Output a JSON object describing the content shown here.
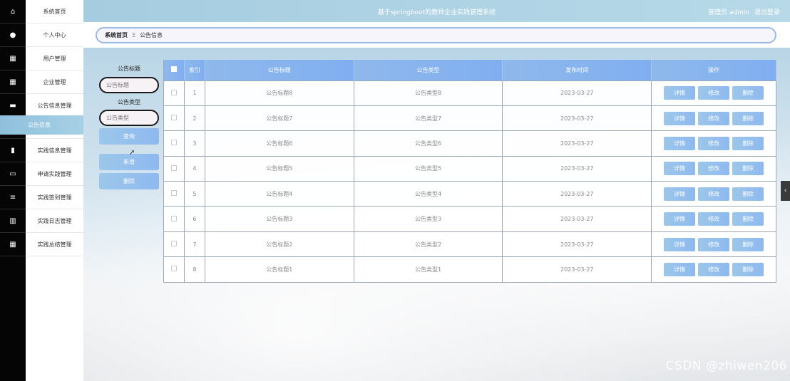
{
  "app": {
    "title": "基于springboot的教师企业实践管理系统",
    "user_role": "管理员 admin",
    "logout": "退出登录"
  },
  "sidebar": {
    "items": [
      {
        "label": "系统首页",
        "icon": "home-icon"
      },
      {
        "label": "个人中心",
        "icon": "user-icon"
      },
      {
        "label": "用户管理",
        "icon": "grid-icon"
      },
      {
        "label": "企业管理",
        "icon": "grid-icon"
      },
      {
        "label": "公告信息管理",
        "icon": "monitor-icon"
      },
      {
        "label": "公告信息",
        "icon": "",
        "active": true
      },
      {
        "label": "实践信息管理",
        "icon": "clipboard-icon"
      },
      {
        "label": "申请实践管理",
        "icon": "ticket-icon"
      },
      {
        "label": "实践签到管理",
        "icon": "list-icon"
      },
      {
        "label": "实践日志管理",
        "icon": "chart-icon"
      },
      {
        "label": "实践总结管理",
        "icon": "grid-icon"
      }
    ]
  },
  "breadcrumb": {
    "home": "系统首页",
    "sep": "Ξ",
    "current": "公告信息"
  },
  "search": {
    "title_label": "公告标题",
    "title_placeholder": "公告标题",
    "type_label": "公告类型",
    "type_placeholder": "公告类型",
    "query": "查询",
    "add": "新增",
    "delete": "删除"
  },
  "table": {
    "headers": [
      "索引",
      "公告标题",
      "公告类型",
      "发布时间",
      "操作"
    ],
    "actions": {
      "detail": "详情",
      "edit": "修改",
      "delete": "删除"
    },
    "rows": [
      {
        "idx": "1",
        "title": "公告标题8",
        "type": "公告类型8",
        "time": "2023-03-27"
      },
      {
        "idx": "2",
        "title": "公告标题7",
        "type": "公告类型7",
        "time": "2023-03-27"
      },
      {
        "idx": "3",
        "title": "公告标题6",
        "type": "公告类型6",
        "time": "2023-03-27"
      },
      {
        "idx": "4",
        "title": "公告标题5",
        "type": "公告类型5",
        "time": "2023-03-27"
      },
      {
        "idx": "5",
        "title": "公告标题4",
        "type": "公告类型4",
        "time": "2023-03-27"
      },
      {
        "idx": "6",
        "title": "公告标题3",
        "type": "公告类型3",
        "time": "2023-03-27"
      },
      {
        "idx": "7",
        "title": "公告标题2",
        "type": "公告类型2",
        "time": "2023-03-27"
      },
      {
        "idx": "8",
        "title": "公告标题1",
        "type": "公告类型1",
        "time": "2023-03-27"
      }
    ]
  },
  "watermark": "CSDN @zhiwen206",
  "colors": {
    "accent": "#8fb9ec",
    "active_menu": "#9cc9e2"
  }
}
